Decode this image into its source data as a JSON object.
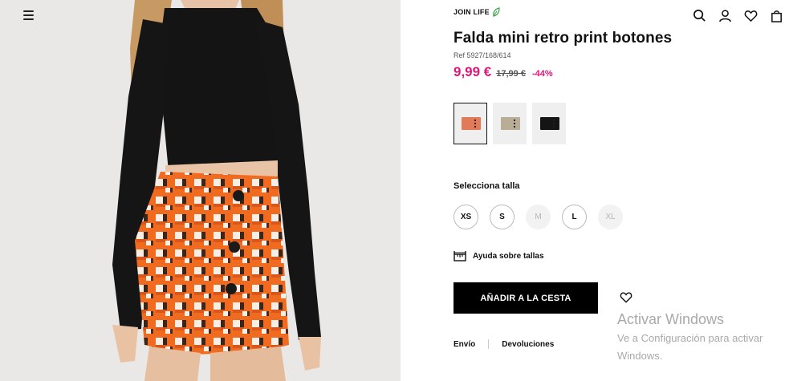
{
  "header": {
    "menu_icon": "hamburger-menu-icon",
    "icons": [
      "search-icon",
      "user-icon",
      "heart-icon",
      "bag-icon"
    ]
  },
  "product": {
    "join_life": "JOIN LIFE",
    "name": "Falda mini retro print botones",
    "ref": "Ref 5927/168/614",
    "price_current": "9,99 €",
    "price_old": "17,99 €",
    "discount": "-44%",
    "colors": [
      {
        "swatch": "#e07a57",
        "selected": true
      },
      {
        "swatch": "#b9ad98",
        "selected": false
      },
      {
        "swatch": "#151515",
        "selected": false
      }
    ],
    "size_label": "Selecciona talla",
    "sizes": [
      {
        "label": "XS",
        "available": true
      },
      {
        "label": "S",
        "available": true
      },
      {
        "label": "M",
        "available": false
      },
      {
        "label": "L",
        "available": true
      },
      {
        "label": "XL",
        "available": false
      }
    ],
    "size_help": "Ayuda sobre tallas",
    "add_to_cart": "AÑADIR A LA CESTA",
    "shipping_link": "Envío",
    "returns_link": "Devoluciones"
  },
  "watermark": {
    "title": "Activar Windows",
    "line1": "Ve a Configuración para activar",
    "line2": "Windows."
  },
  "colors": {
    "accent_price": "#e2157a",
    "button_bg": "#000000",
    "join_life_leaf": "#3aa14a"
  }
}
